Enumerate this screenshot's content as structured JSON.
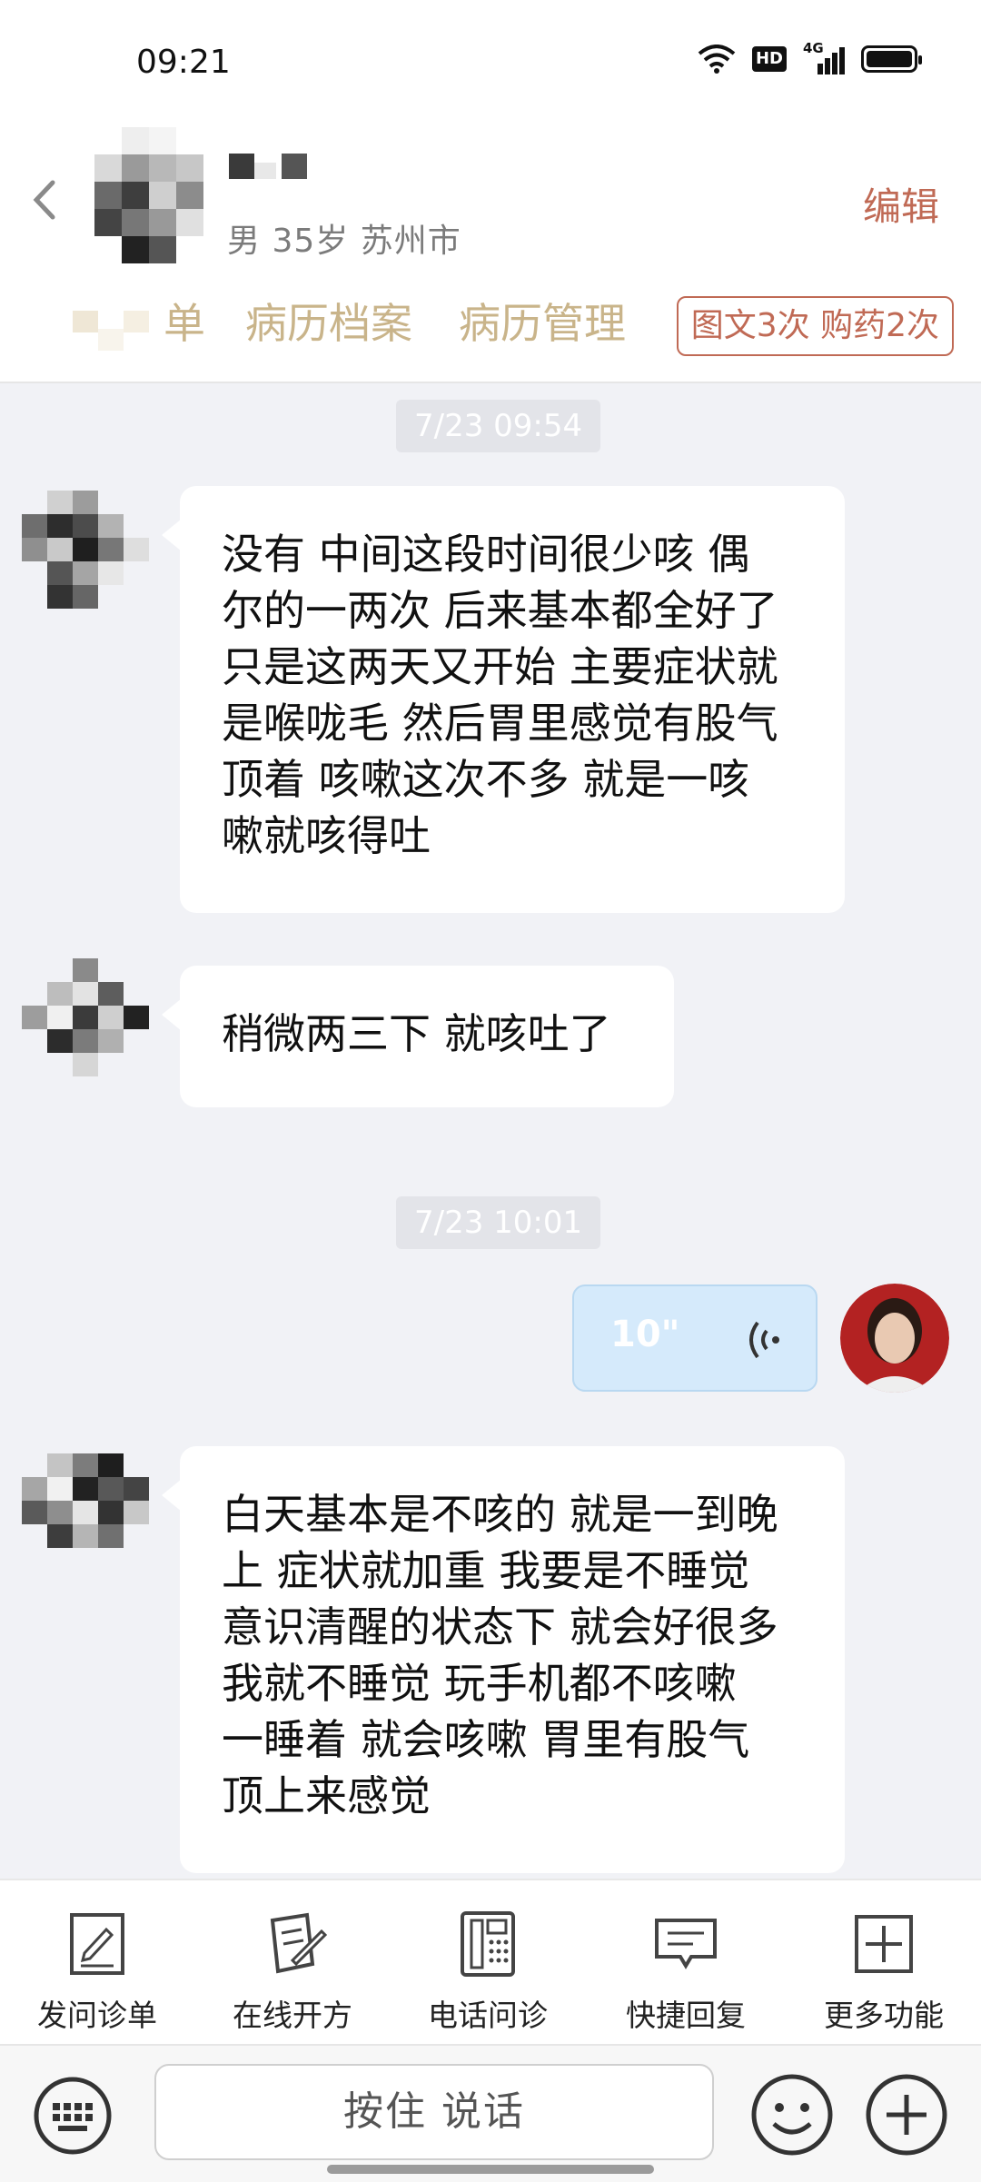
{
  "status_bar": {
    "time": "09:21",
    "hd_badge": "HD",
    "network": "4G"
  },
  "header": {
    "patient_info": "男 35岁  苏州市",
    "edit_label": "编辑",
    "tabs": [
      {
        "label": "单"
      },
      {
        "label": "病历档案"
      },
      {
        "label": "病历管理"
      }
    ],
    "quota_badge": "图文3次 购药2次"
  },
  "chat": {
    "time_1": "7/23 09:54",
    "msg_1": "没有 中间这段时间很少咳 偶\n尔的一两次 后来基本都全好了\n只是这两天又开始 主要症状就\n是喉咙毛 然后胃里感觉有股气\n顶着  咳嗽这次不多 就是一咳\n嗽就咳得吐",
    "msg_2": "稍微两三下 就咳吐了",
    "time_2": "7/23 10:01",
    "voice_duration": "10\"",
    "msg_3": "白天基本是不咳的 就是一到晚\n上 症状就加重 我要是不睡觉\n意识清醒的状态下 就会好很多\n我就不睡觉 玩手机都不咳嗽\n一睡着 就会咳嗽 胃里有股气\n顶上来感觉"
  },
  "actions": [
    {
      "label": "发问诊单",
      "icon": "questionnaire-icon"
    },
    {
      "label": "在线开方",
      "icon": "prescription-icon"
    },
    {
      "label": "电话问诊",
      "icon": "phone-icon"
    },
    {
      "label": "快捷回复",
      "icon": "quick-reply-icon"
    },
    {
      "label": "更多功能",
      "icon": "more-icon"
    }
  ],
  "input_bar": {
    "hold_to_talk": "按住 说话"
  },
  "colors": {
    "accent": "#c06a55",
    "tab_text": "#c9b48a",
    "voice_bubble": "#d5eafb"
  }
}
